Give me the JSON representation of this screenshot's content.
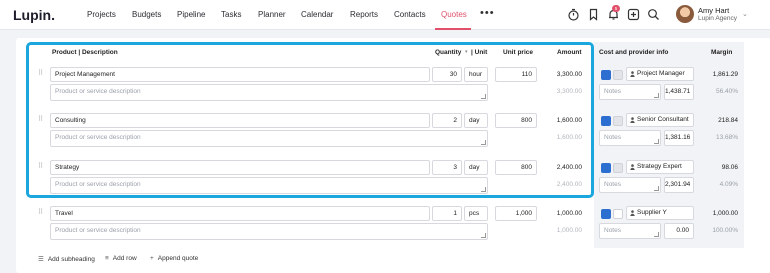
{
  "app": {
    "logo": "Lupin.",
    "nav": [
      "Projects",
      "Budgets",
      "Pipeline",
      "Tasks",
      "Planner",
      "Calendar",
      "Reports",
      "Contacts",
      "Quotes"
    ],
    "active_nav": "Quotes",
    "notification_count": "5",
    "user": {
      "name": "Amy Hart",
      "org": "Lupin Agency"
    }
  },
  "table": {
    "headers": {
      "product": "Product | Description",
      "quantity": "Quantity",
      "unit": "| Unit",
      "unit_price": "Unit price",
      "amount": "Amount",
      "cost_provider": "Cost and provider info",
      "margin": "Margin"
    },
    "description_placeholder": "Product or service description",
    "notes_placeholder": "Notes",
    "rows": [
      {
        "product": "Project Management",
        "quantity": "30",
        "unit": "hour",
        "unit_price": "110",
        "amount": "3,300.00",
        "amount_secondary": "3,300.00",
        "provider": "Project Manager",
        "cost": "1,438.71",
        "margin": "1,861.29",
        "margin_pct": "56.40%"
      },
      {
        "product": "Consulting",
        "quantity": "2",
        "unit": "day",
        "unit_price": "800",
        "amount": "1,600.00",
        "amount_secondary": "1,600.00",
        "provider": "Senior Consultant",
        "cost": "1,381.16",
        "margin": "218.84",
        "margin_pct": "13.68%"
      },
      {
        "product": "Strategy",
        "quantity": "3",
        "unit": "day",
        "unit_price": "800",
        "amount": "2,400.00",
        "amount_secondary": "2,400.00",
        "provider": "Strategy Expert",
        "cost": "2,301.94",
        "margin": "98.06",
        "margin_pct": "4.09%"
      },
      {
        "product": "Travel",
        "quantity": "1",
        "unit": "pcs",
        "unit_price": "1,000",
        "amount": "1,000.00",
        "amount_secondary": "1,000.00",
        "provider": "Supplier Y",
        "cost": "0.00",
        "margin": "1,000.00",
        "margin_pct": "100.00%"
      }
    ]
  },
  "footer": {
    "add_subheading": "Add subheading",
    "add_row": "Add row",
    "append_quote": "Append quote"
  },
  "colors": {
    "accent": "#e0506a",
    "highlight": "#1aa7de",
    "user_button": "#2d6fd1"
  }
}
